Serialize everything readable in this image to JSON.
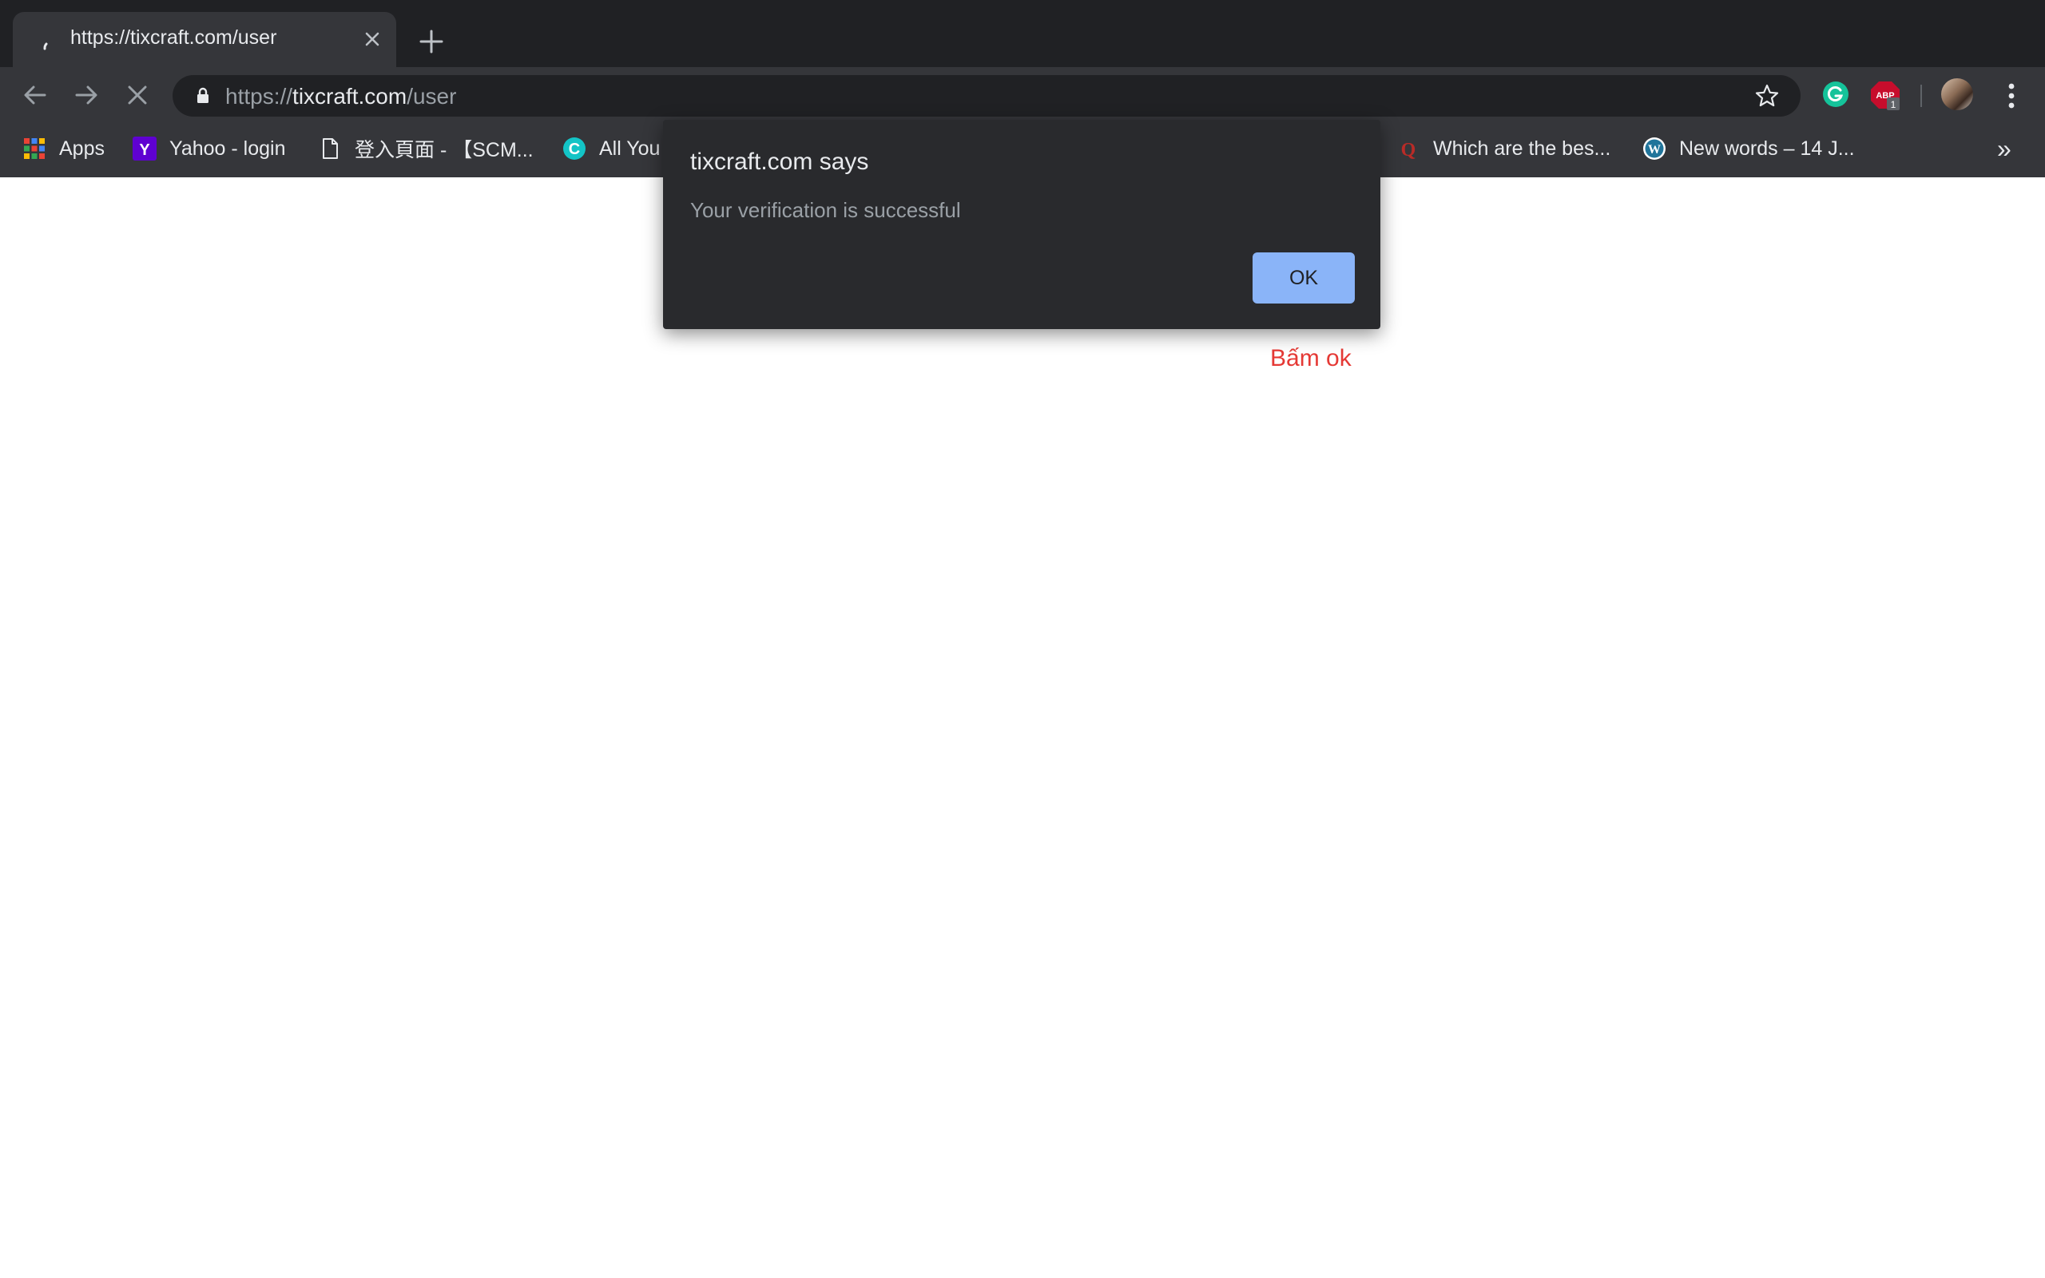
{
  "browser": {
    "tab": {
      "title": "https://tixcraft.com/user"
    },
    "omnibox": {
      "url_scheme": "https://",
      "url_host": "tixcraft.com",
      "url_path": "/user"
    },
    "extensions": [
      {
        "name": "grammarly-icon",
        "color": "#15c39a"
      },
      {
        "name": "adblock-icon",
        "label": "ABP",
        "badge": "1",
        "color": "#c70d2c"
      }
    ],
    "bookmarks": [
      {
        "icon": "apps-grid-icon",
        "label": "Apps"
      },
      {
        "icon": "yahoo-icon",
        "label": "Yahoo - login"
      },
      {
        "icon": "page-icon",
        "label": "登入頁面 - 【SCM..."
      },
      {
        "icon": "c-logo-icon",
        "label": "All You"
      },
      {
        "icon": "quora-icon",
        "label": "Which are the bes..."
      },
      {
        "icon": "wordpress-icon",
        "label": "New words – 14 J..."
      }
    ],
    "bookmarks_more": "»"
  },
  "dialog": {
    "title": "tixcraft.com says",
    "message": "Your verification is successful",
    "ok_label": "OK"
  },
  "page": {
    "annotation": "Bấm ok"
  },
  "colors": {
    "annotation": "#e53935",
    "ok_button": "#8ab4f8",
    "chrome_dark": "#202124",
    "chrome_toolbar": "#35363a"
  }
}
